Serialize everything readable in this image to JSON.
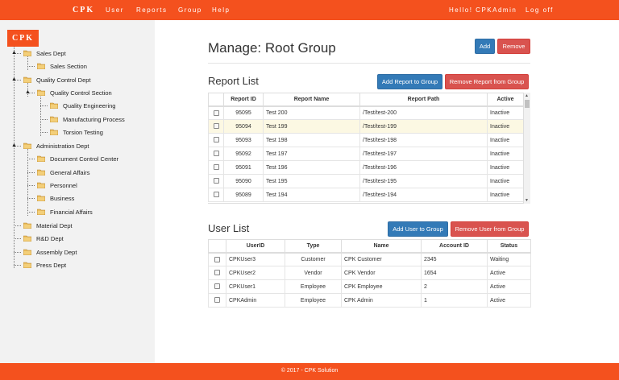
{
  "nav": {
    "brand": "CPK",
    "items": [
      "User",
      "Reports",
      "Group",
      "Help"
    ],
    "greeting": "Hello! CPKAdmin",
    "logoff": "Log off"
  },
  "sidebar": {
    "logo": "CPK",
    "tree": [
      "Sales Dept",
      "Sales Section",
      "Quality Control Dept",
      "Quality Control Section",
      "Quality Engineering",
      "Manufacturing Process",
      "Torsion Testing",
      "Administration Dept",
      "Document Control Center",
      "General Affairs",
      "Personnel",
      "Business",
      "Financial Affairs",
      "Material Dept",
      "R&D Dept",
      "Assembly Dept",
      "Press Dept"
    ]
  },
  "page": {
    "title": "Manage: Root Group",
    "add": "Add",
    "remove": "Remove"
  },
  "reports": {
    "title": "Report List",
    "add_btn": "Add Report to Group",
    "remove_btn": "Remove Report from Group",
    "headers": [
      "Report ID",
      "Report Name",
      "Report Path",
      "Active"
    ],
    "rows": [
      {
        "id": "95095",
        "name": "Test 200",
        "path": "/Test/test-200",
        "active": "Inactive"
      },
      {
        "id": "95094",
        "name": "Test 199",
        "path": "/Test/test-199",
        "active": "Inactive"
      },
      {
        "id": "95093",
        "name": "Test 198",
        "path": "/Test/test-198",
        "active": "Inactive"
      },
      {
        "id": "95092",
        "name": "Test 197",
        "path": "/Test/test-197",
        "active": "Inactive"
      },
      {
        "id": "95091",
        "name": "Test 196",
        "path": "/Test/test-196",
        "active": "Inactive"
      },
      {
        "id": "95090",
        "name": "Test 195",
        "path": "/Test/test-195",
        "active": "Inactive"
      },
      {
        "id": "95089",
        "name": "Test 194",
        "path": "/Test/test-194",
        "active": "Inactive"
      }
    ]
  },
  "users": {
    "title": "User List",
    "add_btn": "Add User to Group",
    "remove_btn": "Remove User from Group",
    "headers": [
      "UserID",
      "Type",
      "Name",
      "Account ID",
      "Status"
    ],
    "rows": [
      {
        "uid": "CPKUser3",
        "type": "Customer",
        "name": "CPK Customer",
        "acct": "2345",
        "status": "Waiting"
      },
      {
        "uid": "CPKUser2",
        "type": "Vendor",
        "name": "CPK Vendor",
        "acct": "1654",
        "status": "Active"
      },
      {
        "uid": "CPKUser1",
        "type": "Employee",
        "name": "CPK Employee",
        "acct": "2",
        "status": "Active"
      },
      {
        "uid": "CPKAdmin",
        "type": "Employee",
        "name": "CPK Admin",
        "acct": "1",
        "status": "Active"
      }
    ]
  },
  "footer": "© 2017 - CPK Solution",
  "colors": {
    "accent": "#f4511e",
    "primary": "#337ab7",
    "danger": "#d9534f",
    "highlight": "#fcf8e3"
  }
}
